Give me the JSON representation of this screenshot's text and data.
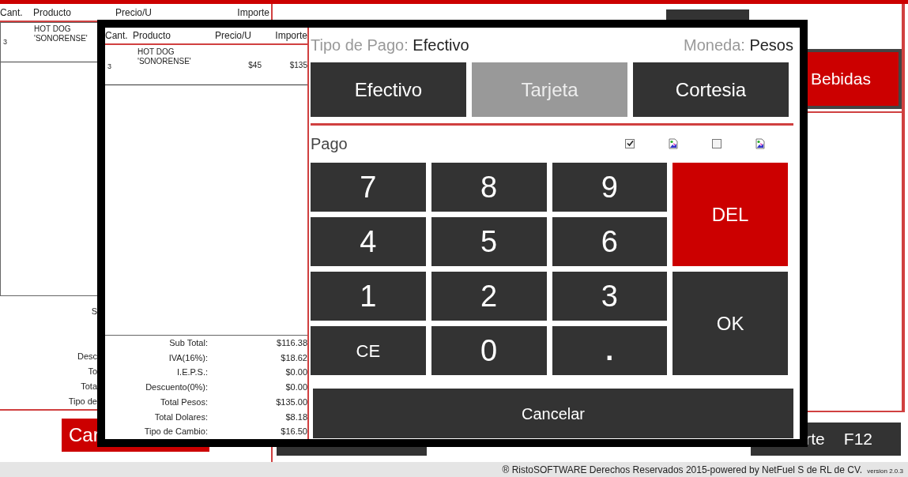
{
  "background": {
    "table": {
      "columns": [
        "Cant.",
        "Producto",
        "Precio/U",
        "Importe"
      ],
      "rows": [
        {
          "qty": "3",
          "product": "HOT DOG 'SONORENSE'"
        }
      ]
    },
    "summary_labels": [
      "S",
      "Desc",
      "To",
      "Tota",
      "Tipo de"
    ],
    "cancel_button": "Car",
    "category_button": "Bebidas",
    "function_button": {
      "label": "rte",
      "key": "F12"
    }
  },
  "modal": {
    "table": {
      "columns": [
        "Cant.",
        "Producto",
        "Precio/U",
        "Importe"
      ],
      "rows": [
        {
          "qty": "3",
          "product": "HOT DOG 'SONORENSE'",
          "price": "$45",
          "amount": "$135"
        }
      ]
    },
    "totals": [
      {
        "label": "Sub Total:",
        "value": "$116.38"
      },
      {
        "label": "IVA(16%):",
        "value": "$18.62"
      },
      {
        "label": "I.E.P.S.:",
        "value": "$0.00"
      },
      {
        "label": "Descuento(0%):",
        "value": "$0.00"
      },
      {
        "label": "Total Pesos:",
        "value": "$135.00"
      },
      {
        "label": "Total Dolares:",
        "value": "$8.18"
      },
      {
        "label": "Tipo de Cambio:",
        "value": "$16.50"
      }
    ],
    "payment_type": {
      "label": "Tipo de Pago:",
      "value": "Efectivo"
    },
    "currency": {
      "label": "Moneda:",
      "value": "Pesos"
    },
    "payment_methods": [
      {
        "label": "Efectivo",
        "disabled": false
      },
      {
        "label": "Tarjeta",
        "disabled": true
      },
      {
        "label": "Cortesia",
        "disabled": false
      }
    ],
    "payment_label": "Pago",
    "options": [
      {
        "kind": "checkbox",
        "checked": true
      },
      {
        "kind": "image"
      },
      {
        "kind": "checkbox",
        "checked": false
      },
      {
        "kind": "image"
      }
    ],
    "keypad": [
      {
        "label": "7",
        "kind": "digit"
      },
      {
        "label": "8",
        "kind": "digit"
      },
      {
        "label": "9",
        "kind": "digit"
      },
      {
        "label": "DEL",
        "kind": "delete"
      },
      {
        "label": "4",
        "kind": "digit"
      },
      {
        "label": "5",
        "kind": "digit"
      },
      {
        "label": "6",
        "kind": "digit"
      },
      {
        "label": "1",
        "kind": "digit"
      },
      {
        "label": "2",
        "kind": "digit"
      },
      {
        "label": "3",
        "kind": "digit"
      },
      {
        "label": "OK",
        "kind": "ok"
      },
      {
        "label": "CE",
        "kind": "clear"
      },
      {
        "label": "0",
        "kind": "digit"
      },
      {
        "label": ".",
        "kind": "point"
      }
    ],
    "cancel": "Cancelar"
  },
  "footer": {
    "copyright": "® RistoSOFTWARE Derechos Reservados 2015-powered by NetFuel S de RL de CV.",
    "version": "version 2.0.3"
  }
}
